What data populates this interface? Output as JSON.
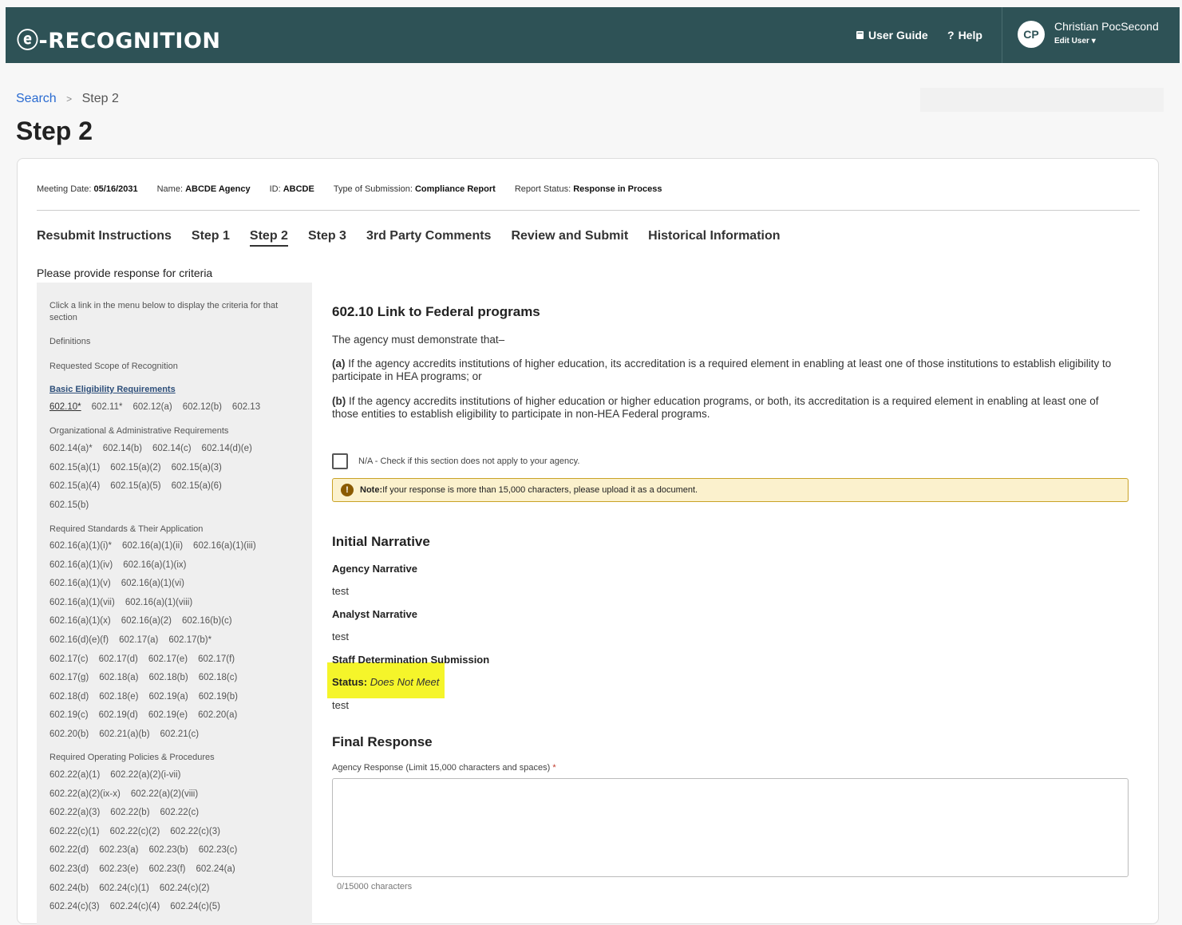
{
  "header": {
    "logo": "ⓔ-RECOGNITION",
    "user_guide": "User Guide",
    "help": "Help",
    "avatar_initials": "CP",
    "user_name": "Christian PocSecond",
    "edit_user": "Edit User"
  },
  "breadcrumb": {
    "search": "Search",
    "current": "Step 2"
  },
  "page_title": "Step 2",
  "meta": {
    "meeting_date_label": "Meeting Date:",
    "meeting_date": "05/16/2031",
    "name_label": "Name:",
    "name": "ABCDE Agency",
    "id_label": "ID:",
    "id": "ABCDE",
    "type_label": "Type of Submission:",
    "type": "Compliance Report",
    "status_label": "Report Status:",
    "status": "Response in Process"
  },
  "tabs": [
    "Resubmit Instructions",
    "Step 1",
    "Step 2",
    "Step 3",
    "3rd Party Comments",
    "Review and Submit",
    "Historical Information"
  ],
  "prompt": "Please provide response for criteria",
  "sidebar": {
    "intro": "Click a link in the menu below to display the criteria for that section",
    "definitions": "Definitions",
    "requested_scope": "Requested Scope of Recognition",
    "basic_heading": "Basic Eligibility Requirements",
    "basic_items": [
      "602.10*",
      "602.11*",
      "602.12(a)",
      "602.12(b)",
      "602.13"
    ],
    "org_heading": "Organizational & Administrative Requirements",
    "org_rows": [
      [
        "602.14(a)*",
        "602.14(b)",
        "602.14(c)",
        "602.14(d)(e)"
      ],
      [
        "602.15(a)(1)",
        "602.15(a)(2)",
        "602.15(a)(3)"
      ],
      [
        "602.15(a)(4)",
        "602.15(a)(5)",
        "602.15(a)(6)"
      ],
      [
        "602.15(b)"
      ]
    ],
    "std_heading": "Required Standards & Their Application",
    "std_rows": [
      [
        "602.16(a)(1)(i)*",
        "602.16(a)(1)(ii)",
        "602.16(a)(1)(iii)"
      ],
      [
        "602.16(a)(1)(iv)",
        "602.16(a)(1)(ix)"
      ],
      [
        "602.16(a)(1)(v)",
        "602.16(a)(1)(vi)"
      ],
      [
        "602.16(a)(1)(vii)",
        "602.16(a)(1)(viii)"
      ],
      [
        "602.16(a)(1)(x)",
        "602.16(a)(2)",
        "602.16(b)(c)"
      ],
      [
        "602.16(d)(e)(f)",
        "602.17(a)",
        "602.17(b)*"
      ],
      [
        "602.17(c)",
        "602.17(d)",
        "602.17(e)",
        "602.17(f)"
      ],
      [
        "602.17(g)",
        "602.18(a)",
        "602.18(b)",
        "602.18(c)"
      ],
      [
        "602.18(d)",
        "602.18(e)",
        "602.19(a)",
        "602.19(b)"
      ],
      [
        "602.19(c)",
        "602.19(d)",
        "602.19(e)",
        "602.20(a)"
      ],
      [
        "602.20(b)",
        "602.21(a)(b)",
        "602.21(c)"
      ]
    ],
    "pol_heading": "Required Operating Policies & Procedures",
    "pol_rows": [
      [
        "602.22(a)(1)",
        "602.22(a)(2)(i-vii)"
      ],
      [
        "602.22(a)(2)(ix-x)",
        "602.22(a)(2)(viii)"
      ],
      [
        "602.22(a)(3)",
        "602.22(b)",
        "602.22(c)"
      ],
      [
        "602.22(c)(1)",
        "602.22(c)(2)",
        "602.22(c)(3)"
      ],
      [
        "602.22(d)",
        "602.23(a)",
        "602.23(b)",
        "602.23(c)"
      ],
      [
        "602.23(d)",
        "602.23(e)",
        "602.23(f)",
        "602.24(a)"
      ],
      [
        "602.24(b)",
        "602.24(c)(1)",
        "602.24(c)(2)"
      ],
      [
        "602.24(c)(3)",
        "602.24(c)(4)",
        "602.24(c)(5)"
      ]
    ]
  },
  "section": {
    "title": "602.10 Link to Federal programs",
    "intro": "The agency must demonstrate that–",
    "a_label": "(a)",
    "a_text": " If the agency accredits institutions of higher education, its accreditation is a required element in enabling at least one of those institutions to establish eligibility to participate in HEA programs; or",
    "b_label": "(b)",
    "b_text": " If the agency accredits institutions of higher education or higher education programs, or both, its accreditation is a required element in enabling at least one of those entities to establish eligibility to participate in non-HEA Federal programs.",
    "na_label": "N/A - Check if this section does not apply to your agency.",
    "note_label": "Note:",
    "note_text": " If your response is more than 15,000 characters, please upload it as a document."
  },
  "initial": {
    "title": "Initial Narrative",
    "agency_label": "Agency Narrative",
    "agency_text": "test",
    "analyst_label": "Analyst Narrative",
    "analyst_text": "test",
    "staff_label": "Staff Determination Submission",
    "status_label": "Status:",
    "status_value": "Does Not Meet",
    "staff_text": "test"
  },
  "final": {
    "title": "Final Response",
    "response_label": "Agency Response (Limit 15,000 characters and spaces)",
    "required_mark": "*",
    "char_count": "0/15000 characters"
  },
  "colors": {
    "header": "#2e5256",
    "link": "#2a6bd1",
    "note_bg": "#fbf1cd",
    "highlight": "#f5f52a"
  }
}
